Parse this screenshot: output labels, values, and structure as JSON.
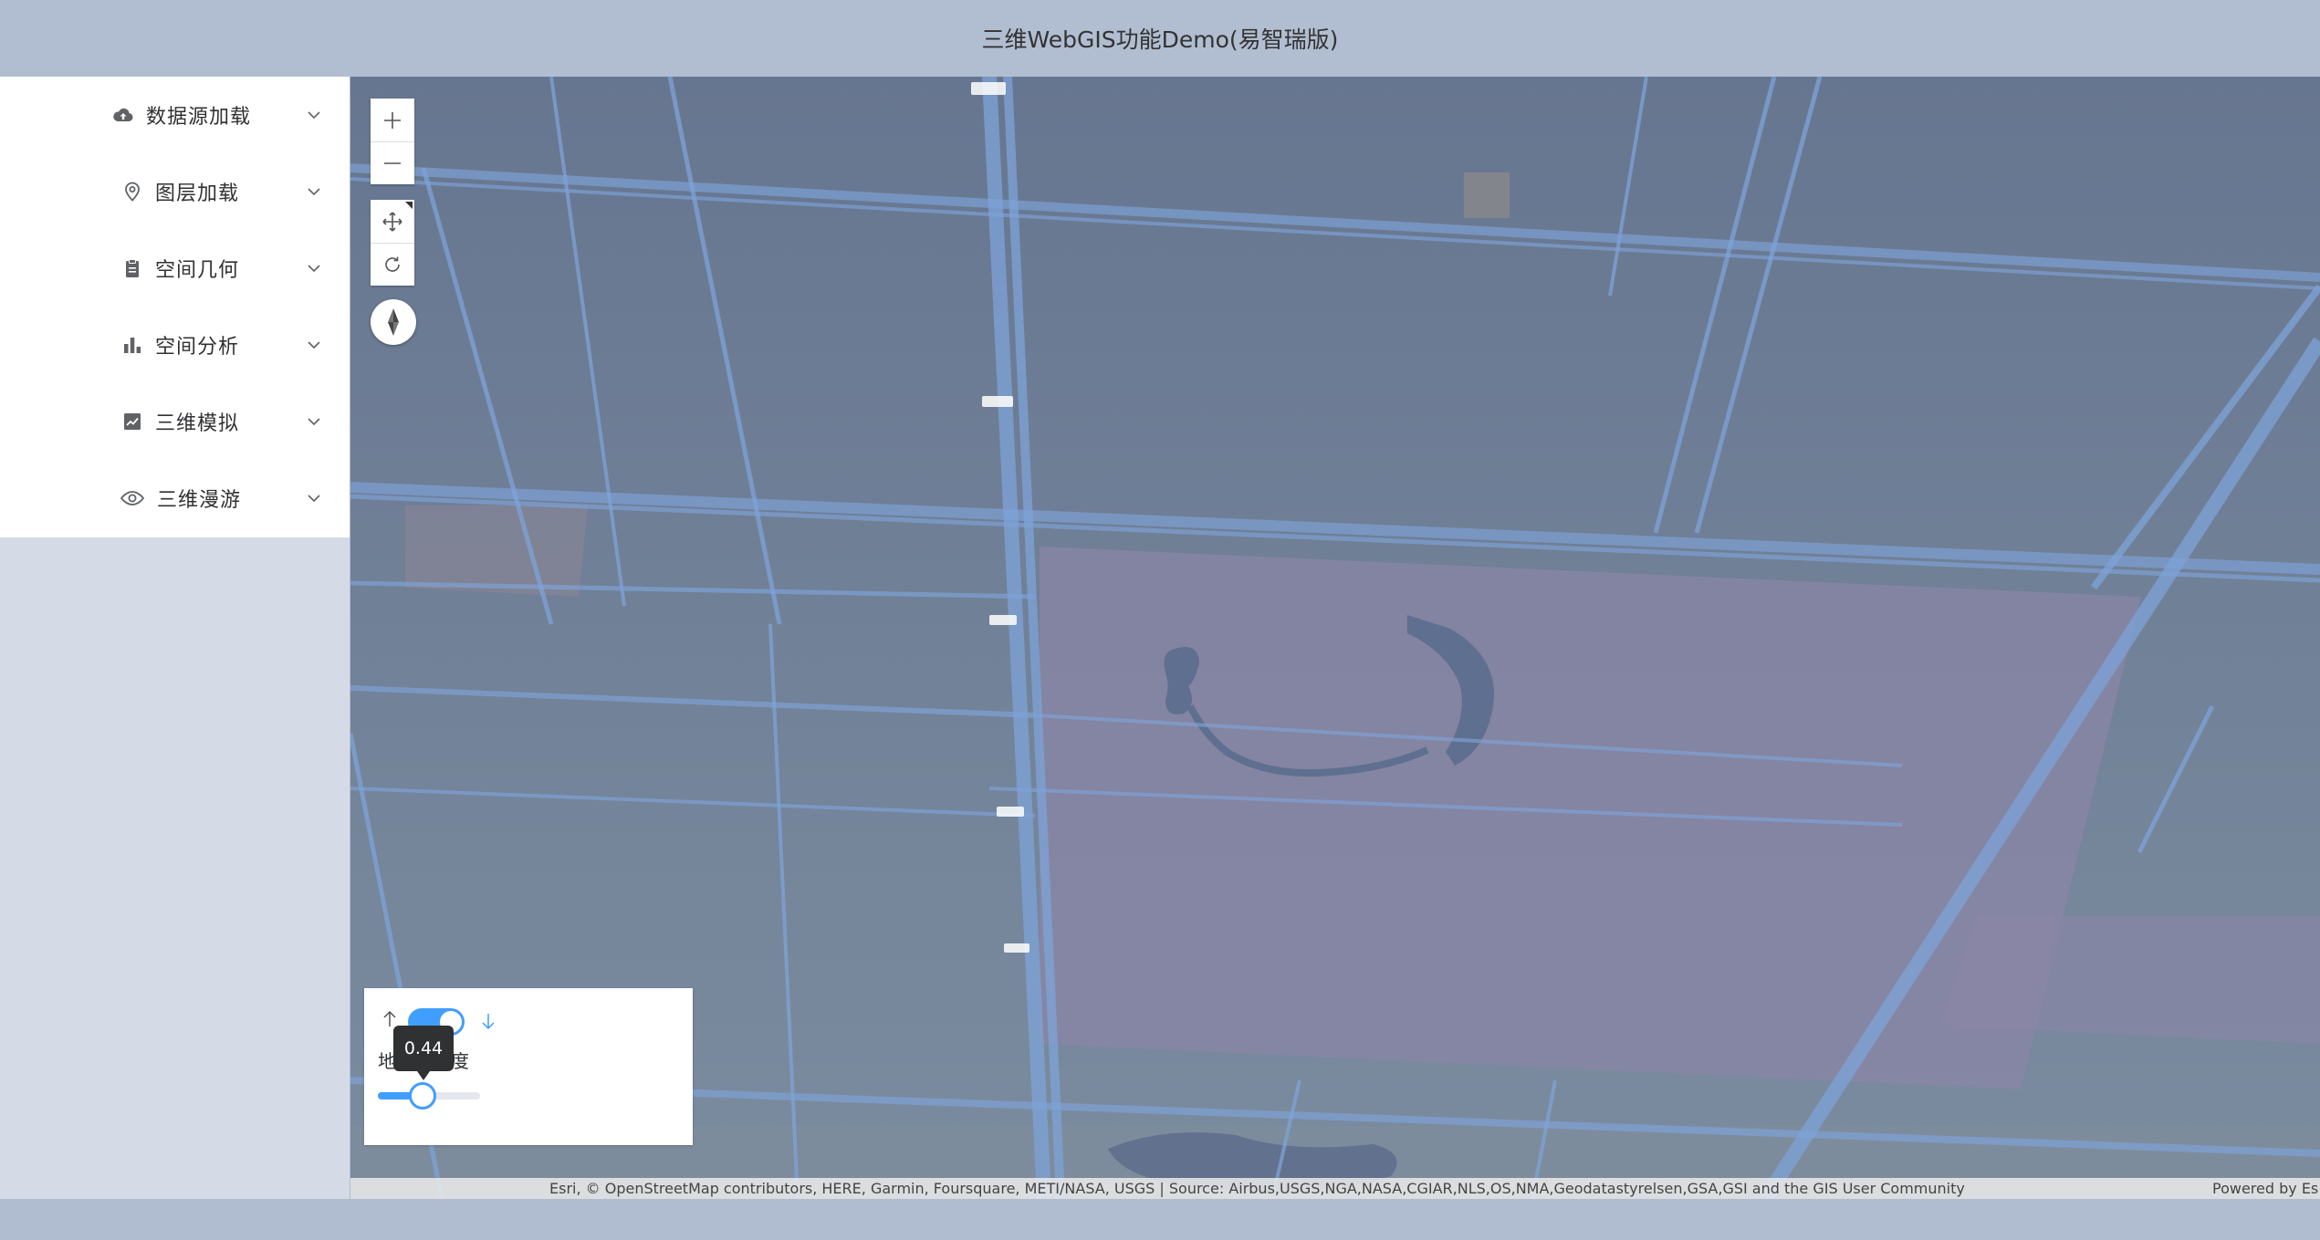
{
  "header": {
    "title": "三维WebGIS功能Demo(易智瑞版)"
  },
  "sidebar": {
    "items": [
      {
        "label": "数据源加载",
        "icon": "cloud-upload-icon"
      },
      {
        "label": "图层加载",
        "icon": "location-pin-icon"
      },
      {
        "label": "空间几何",
        "icon": "clipboard-icon"
      },
      {
        "label": "空间分析",
        "icon": "bar-chart-icon"
      },
      {
        "label": "三维模拟",
        "icon": "line-chart-icon"
      },
      {
        "label": "三维漫游",
        "icon": "eye-icon"
      }
    ]
  },
  "map": {
    "controls": [
      "zoom-in-icon",
      "zoom-out-icon",
      "pan-icon",
      "rotate-icon",
      "compass-icon"
    ],
    "attribution": "Esri, © OpenStreetMap contributors, HERE, Garmin, Foursquare, METI/NASA, USGS | Source: Airbus,USGS,NGA,NASA,CGIAR,NLS,OS,NMA,Geodatastyrelsen,GSA,GSI and the GIS User Community",
    "powered_by": "Powered by Es"
  },
  "panel": {
    "toggle_on": true,
    "label_left": "地",
    "label_right": "度",
    "slider_value": 0.44,
    "tooltip": "0.44",
    "accent": "#409eff"
  }
}
